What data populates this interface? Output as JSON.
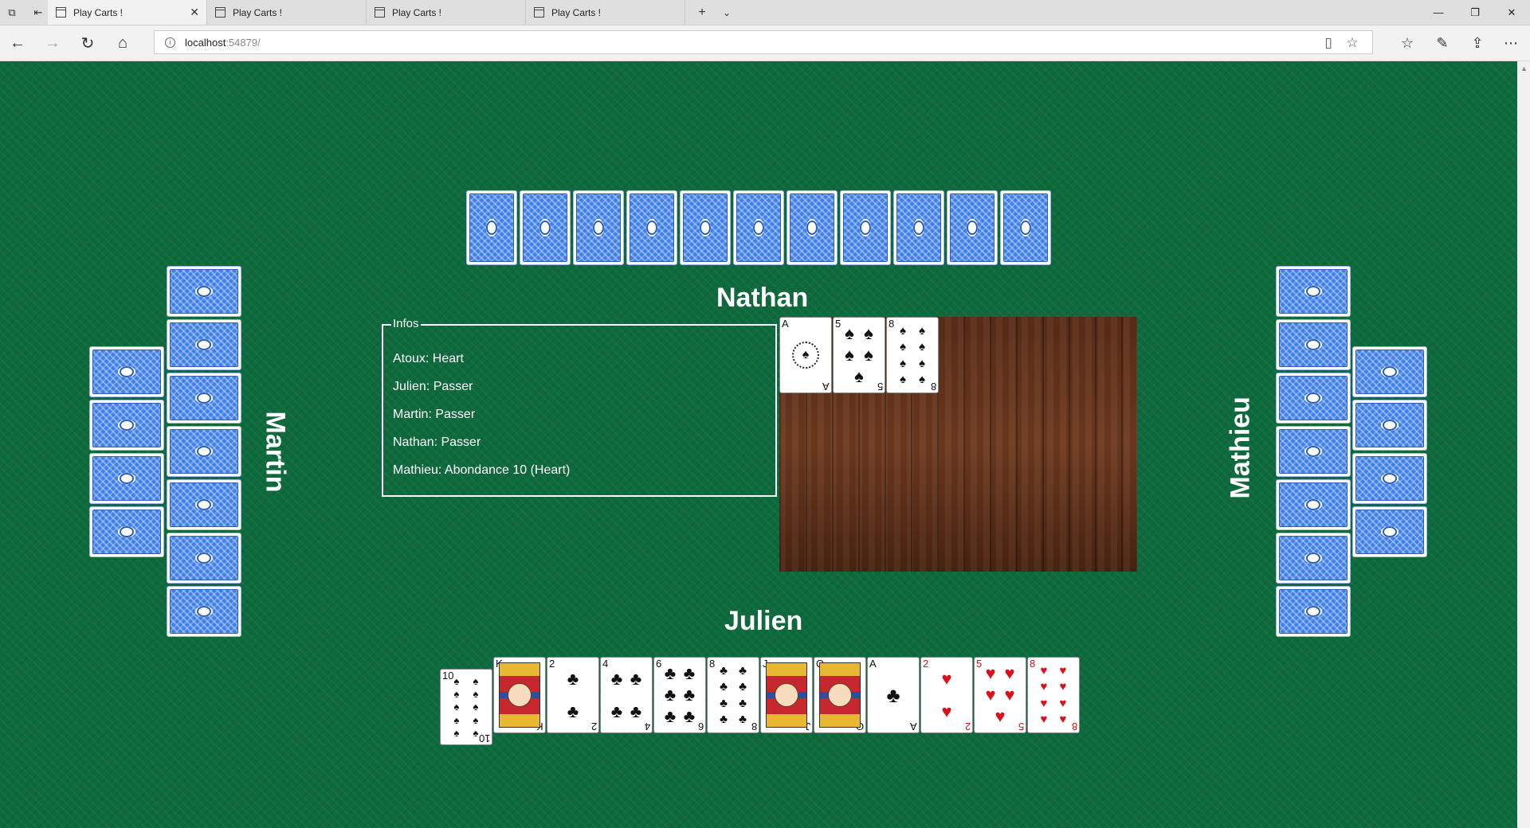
{
  "browser": {
    "tabs": [
      {
        "label": "Play Carts !",
        "active": true
      },
      {
        "label": "Play Carts !",
        "active": false
      },
      {
        "label": "Play Carts !",
        "active": false
      },
      {
        "label": "Play Carts !",
        "active": false
      }
    ],
    "address": {
      "host": "localhost",
      "port": ":54879/"
    }
  },
  "game": {
    "players": {
      "top": {
        "name": "Nathan",
        "hidden_cards": 11
      },
      "left": {
        "name": "Martin",
        "hidden_cards": 11
      },
      "right": {
        "name": "Mathieu",
        "hidden_cards": 11
      },
      "bottom": {
        "name": "Julien"
      }
    },
    "infos": {
      "legend": "Infos",
      "lines": [
        "Atoux: Heart",
        "Julien: Passer",
        "Martin: Passer",
        "Nathan: Passer",
        "Mathieu: Abondance 10 (Heart)"
      ]
    },
    "table_cards": [
      {
        "rank": "A",
        "suit": "♠",
        "color": "black"
      },
      {
        "rank": "5",
        "suit": "♠",
        "color": "black"
      },
      {
        "rank": "8",
        "suit": "♠",
        "color": "black"
      }
    ],
    "hand": [
      {
        "rank": "10",
        "suit": "♠",
        "color": "black",
        "selected": true
      },
      {
        "rank": "K",
        "suit": "♠",
        "color": "black"
      },
      {
        "rank": "2",
        "suit": "♣",
        "color": "black"
      },
      {
        "rank": "4",
        "suit": "♣",
        "color": "black"
      },
      {
        "rank": "6",
        "suit": "♣",
        "color": "black"
      },
      {
        "rank": "8",
        "suit": "♣",
        "color": "black"
      },
      {
        "rank": "J",
        "suit": "♣",
        "color": "black"
      },
      {
        "rank": "Q",
        "suit": "♣",
        "color": "black"
      },
      {
        "rank": "A",
        "suit": "♣",
        "color": "black"
      },
      {
        "rank": "2",
        "suit": "♥",
        "color": "red"
      },
      {
        "rank": "5",
        "suit": "♥",
        "color": "red"
      },
      {
        "rank": "8",
        "suit": "♥",
        "color": "red"
      }
    ]
  },
  "colors": {
    "felt": "#0e6a3d",
    "card_back": "#3d7ee8",
    "red_suit": "#d8111c"
  }
}
